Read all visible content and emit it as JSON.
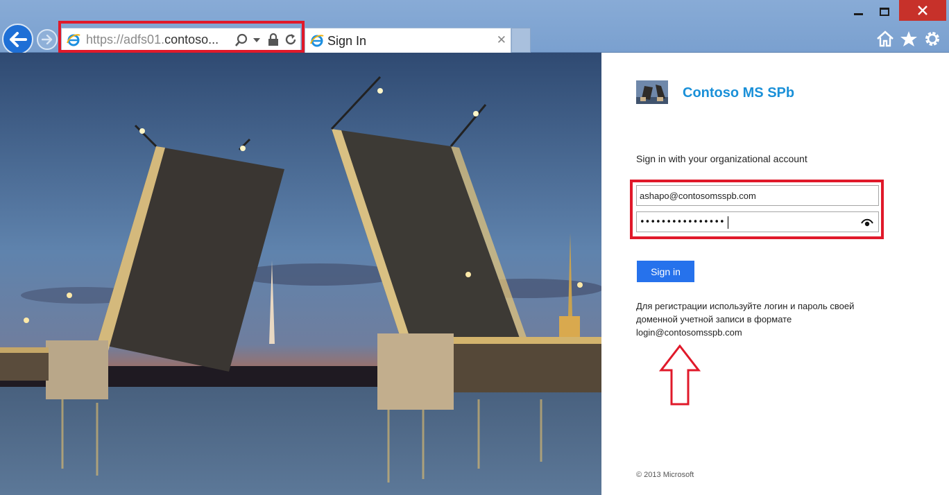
{
  "browser": {
    "url_prefix": "https://",
    "url_host_dim": "adfs01.",
    "url_host_rest": "contoso...",
    "tab_title": "Sign In",
    "tab_close": "✕",
    "icons": [
      "ie-logo-icon",
      "search-icon",
      "dropdown-icon",
      "lock-icon",
      "refresh-icon",
      "home-icon",
      "favorites-star-icon",
      "settings-gear-icon"
    ]
  },
  "window": {
    "buttons": [
      "minimize",
      "restore",
      "close"
    ]
  },
  "signin_panel": {
    "org_name": "Contoso MS SPb",
    "prompt": "Sign in with your organizational account",
    "email_value": "ashapo@contosomsspb.com",
    "password_mask": "••••••••••••••••",
    "signin_button": "Sign in",
    "help_lines": [
      "Для регистрации используйте логин и пароль своей",
      "доменной учетной записи в формате",
      "login@contosomsspb.com"
    ],
    "copyright": "© 2013 Microsoft"
  },
  "colors": {
    "accent_blue": "#2672ec",
    "org_name": "#1a90d8",
    "highlight_red": "#e0192a",
    "chrome_blue": "#7aa0cf"
  }
}
